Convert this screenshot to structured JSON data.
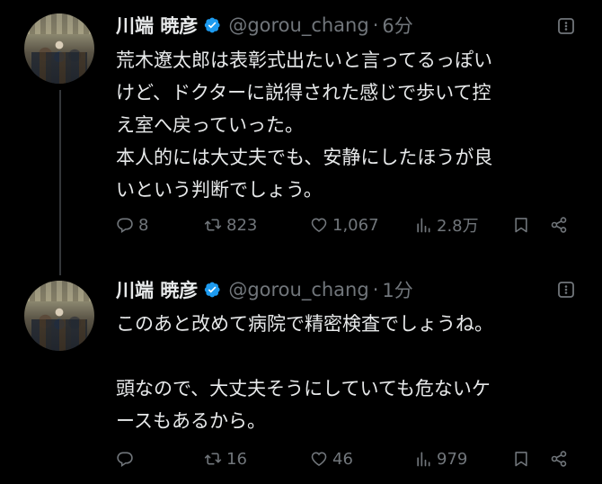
{
  "tweets": [
    {
      "author": {
        "display_name": "川端 暁彦",
        "handle": "@gorou_chang",
        "verified": true,
        "avatar": "photo-avatar"
      },
      "separator": "·",
      "time": "6分",
      "text_lines": [
        "荒木遼太郎は表彰式出たいと言ってるっぽい",
        "けど、ドクターに説得された感じで歩いて控",
        "え室へ戻っていった。",
        "本人的には大丈夫でも、安静にしたほうが良",
        "いという判断でしょう。"
      ],
      "stats": {
        "replies": "8",
        "reposts": "823",
        "likes": "1,067",
        "views": "2.8万"
      }
    },
    {
      "author": {
        "display_name": "川端 暁彦",
        "handle": "@gorou_chang",
        "verified": true,
        "avatar": "photo-avatar"
      },
      "separator": "·",
      "time": "1分",
      "text_lines": [
        "このあと改めて病院で精密検査でしょうね。",
        "",
        "頭なので、大丈夫そうにしていても危ないケ",
        "ースもあるから。"
      ],
      "stats": {
        "replies": "",
        "reposts": "16",
        "likes": "46",
        "views": "979"
      }
    }
  ],
  "icons": {
    "verified": "verified-badge-icon",
    "more": "more-icon",
    "reply": "reply-icon",
    "repost": "repost-icon",
    "like": "heart-icon",
    "views": "views-icon",
    "bookmark": "bookmark-icon",
    "share": "share-icon"
  },
  "colors": {
    "background": "#000000",
    "text_primary": "#e7e9ea",
    "text_secondary": "#71767b",
    "verified_blue": "#1d9bf0",
    "thread_line": "#333639"
  }
}
